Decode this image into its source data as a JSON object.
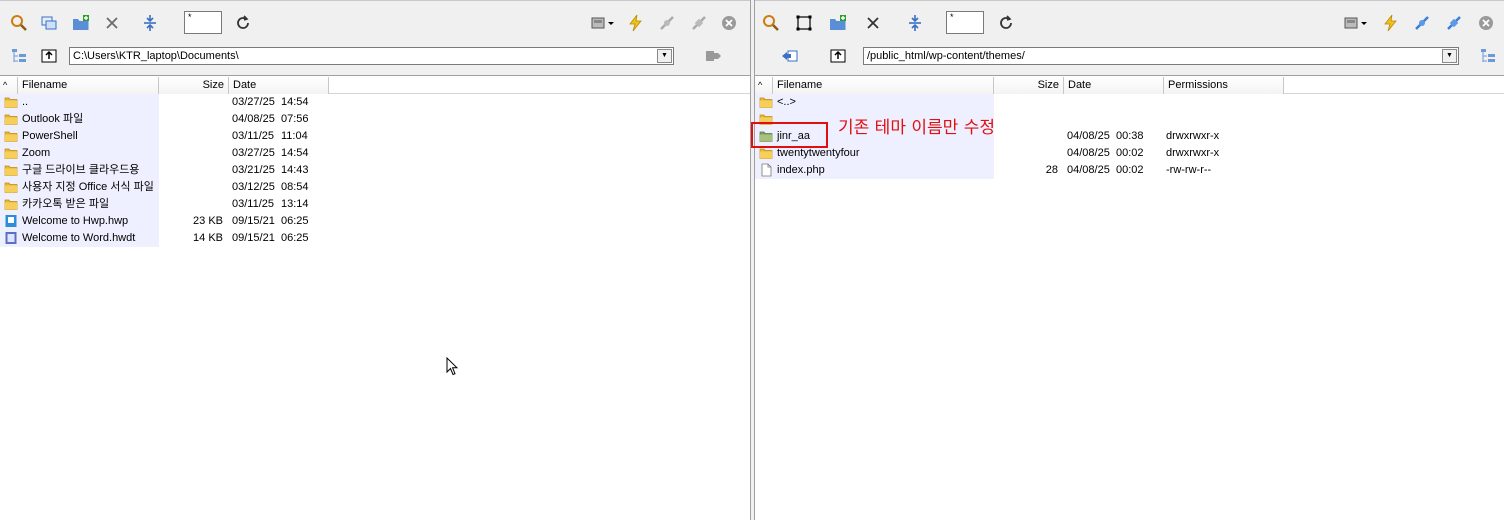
{
  "left": {
    "filter_value": "*",
    "path": "C:\\Users\\KTR_laptop\\Documents\\",
    "columns": {
      "filename": "Filename",
      "size": "Size",
      "date": "Date",
      "sort_arrow": "^"
    },
    "files": [
      {
        "name": "..",
        "size": "",
        "date": "03/27/25",
        "time": "14:54",
        "type": "folder"
      },
      {
        "name": "Outlook 파일",
        "size": "",
        "date": "04/08/25",
        "time": "07:56",
        "type": "folder"
      },
      {
        "name": "PowerShell",
        "size": "",
        "date": "03/11/25",
        "time": "11:04",
        "type": "folder"
      },
      {
        "name": "Zoom",
        "size": "",
        "date": "03/27/25",
        "time": "14:54",
        "type": "folder"
      },
      {
        "name": "구글 드라이브 클라우드용",
        "size": "",
        "date": "03/21/25",
        "time": "14:43",
        "type": "folder"
      },
      {
        "name": "사용자 지정 Office 서식 파일",
        "size": "",
        "date": "03/12/25",
        "time": "08:54",
        "type": "folder"
      },
      {
        "name": "카카오톡 받은 파일",
        "size": "",
        "date": "03/11/25",
        "time": "13:14",
        "type": "folder"
      },
      {
        "name": "Welcome to Hwp.hwp",
        "size": "23 KB",
        "date": "09/15/21",
        "time": "06:25",
        "type": "hwp"
      },
      {
        "name": "Welcome to Word.hwdt",
        "size": "14 KB",
        "date": "09/15/21",
        "time": "06:25",
        "type": "hwdt"
      }
    ]
  },
  "right": {
    "filter_value": "*",
    "path": "/public_html/wp-content/themes/",
    "columns": {
      "filename": "Filename",
      "size": "Size",
      "date": "Date",
      "permissions": "Permissions",
      "sort_arrow": "^"
    },
    "files": [
      {
        "name": "<..>",
        "size": "",
        "date": "",
        "time": "",
        "perm": "",
        "type": "folder"
      },
      {
        "name": "",
        "size": "",
        "date": "",
        "time": "",
        "perm": "",
        "type": "folder"
      },
      {
        "name": "jinr_aa",
        "size": "",
        "date": "04/08/25",
        "time": "00:38",
        "perm": "drwxrwxr-x",
        "type": "folder-green"
      },
      {
        "name": "twentytwentyfour",
        "size": "",
        "date": "04/08/25",
        "time": "00:02",
        "perm": "drwxrwxr-x",
        "type": "folder"
      },
      {
        "name": "index.php",
        "size": "28",
        "date": "04/08/25",
        "time": "00:02",
        "perm": "-rw-rw-r--",
        "type": "file"
      }
    ]
  },
  "annotation": {
    "text": "기존 테마 이름만 수정",
    "color": "#e01010"
  },
  "colors": {
    "toolbar_bg": "#f0f0f0",
    "folder": "#e8b830",
    "name_highlight": "#eef0ff",
    "accent_blue": "#3a6fc4"
  }
}
